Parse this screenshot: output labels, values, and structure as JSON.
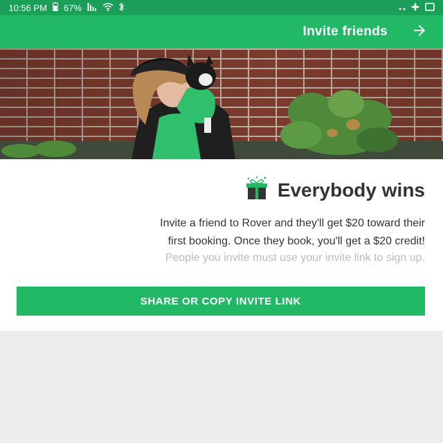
{
  "status_bar": {
    "time": "10:56 PM",
    "battery": "67%"
  },
  "app_bar": {
    "title": "Invite friends",
    "back_icon": "arrow-back-icon"
  },
  "hero": {
    "image": "woman-holding-dog-photo"
  },
  "content": {
    "heading": "Everybody wins",
    "heading_icon": "gift-icon",
    "body_line1": "Invite a friend to Rover and they'll get $20 toward their",
    "body_line2": "first booking. Once they book, you'll get a $20 credit!",
    "hint": "People you invite must use your invite link to sign up.",
    "share_button": "SHARE OR COPY INVITE LINK"
  },
  "colors": {
    "status_bar": "#1b9e57",
    "primary": "#22b966",
    "page_background": "#ebedee"
  }
}
